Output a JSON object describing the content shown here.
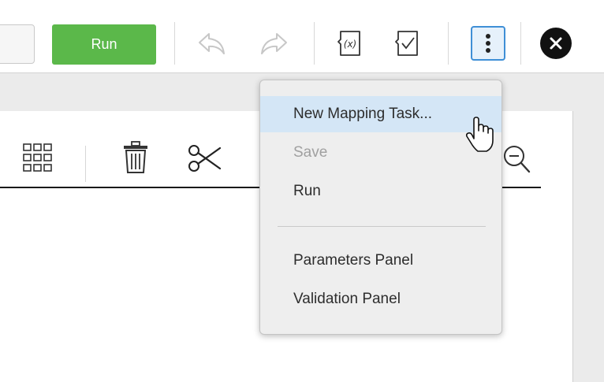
{
  "toolbar": {
    "run_label": "Run",
    "icons": [
      "undo-icon",
      "redo-icon",
      "expression-icon",
      "validate-icon",
      "more-actions-icon",
      "close-icon"
    ],
    "expression_glyph": "(x)"
  },
  "panel": {
    "icons": [
      "grid-icon",
      "trash-icon",
      "scissors-icon",
      "zoom-out-icon"
    ]
  },
  "menu": {
    "items": [
      {
        "label": "New Mapping Task...",
        "state": "hover"
      },
      {
        "label": "Save",
        "state": "disabled"
      },
      {
        "label": "Run",
        "state": "normal"
      },
      {
        "label": "Parameters Panel",
        "state": "normal"
      },
      {
        "label": "Validation Panel",
        "state": "normal"
      }
    ]
  },
  "colors": {
    "run_green": "#5bb84a",
    "accent_blue": "#3f8fd6",
    "highlight": "#d4e6f6"
  }
}
